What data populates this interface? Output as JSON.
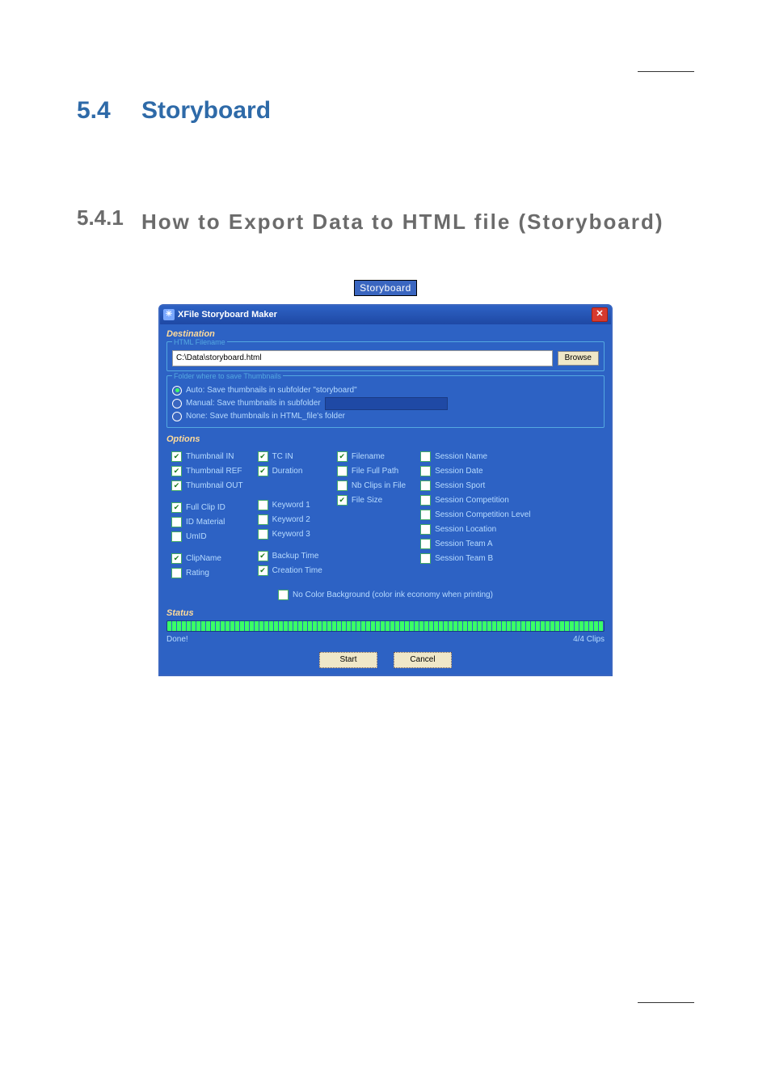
{
  "headings": {
    "h1_num": "5.4",
    "h1_txt": "Storyboard",
    "h2_num": "5.4.1",
    "h2_txt": "How to Export Data to HTML file (Storyboard)"
  },
  "tab_badge": "Storyboard",
  "dialog": {
    "title": "XFile Storyboard Maker",
    "close_glyph": "✕",
    "destination": {
      "title": "Destination",
      "html_legend": "HTML Filename",
      "path_value": "C:\\Data\\storyboard.html",
      "browse_label": "Browse",
      "folder_legend": "Folder where to save Thumbnails",
      "radio_auto": "Auto: Save thumbnails in subfolder \"storyboard\"",
      "radio_manual": "Manual: Save thumbnails in subfolder",
      "radio_none": "None: Save thumbnails in HTML_file's folder"
    },
    "options": {
      "title": "Options",
      "col1": {
        "a": "Thumbnail IN",
        "b": "Thumbnail REF",
        "c": "Thumbnail OUT",
        "d": "Full Clip ID",
        "e": "ID Material",
        "f": "UmID",
        "g": "ClipName",
        "h": "Rating"
      },
      "col2": {
        "a": "TC IN",
        "b": "Duration",
        "c": "Keyword 1",
        "d": "Keyword 2",
        "e": "Keyword 3",
        "f": "Backup Time",
        "g": "Creation Time"
      },
      "col3": {
        "a": "Filename",
        "b": "File Full Path",
        "c": "Nb Clips in File",
        "d": "File Size"
      },
      "col4": {
        "a": "Session Name",
        "b": "Session Date",
        "c": "Session Sport",
        "d": "Session Competition",
        "e": "Session Competition Level",
        "f": "Session Location",
        "g": "Session Team A",
        "h": "Session Team B"
      },
      "eco": "No Color Background (color ink economy when printing)"
    },
    "status": {
      "title": "Status",
      "done": "Done!",
      "count": "4/4 Clips"
    },
    "buttons": {
      "start": "Start",
      "cancel": "Cancel"
    }
  }
}
